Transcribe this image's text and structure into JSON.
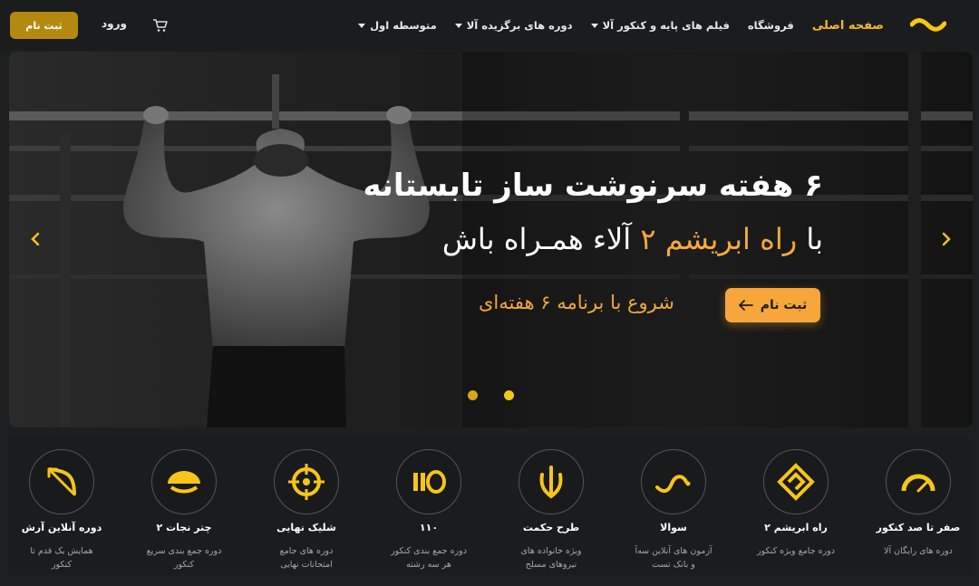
{
  "nav": {
    "menu": [
      {
        "label": "صفحه اصلی",
        "active": true,
        "dropdown": false
      },
      {
        "label": "فروشگاه",
        "active": false,
        "dropdown": false
      },
      {
        "label": "فیلم های پایه و کنکور آلا",
        "active": false,
        "dropdown": true
      },
      {
        "label": "دوره های برگزیده آلا",
        "active": false,
        "dropdown": true
      },
      {
        "label": "متوسطه اول",
        "active": false,
        "dropdown": true
      }
    ],
    "login_label": "ورود",
    "register_label": "ثبت نام",
    "accent_color": "#f5b82e"
  },
  "hero": {
    "headline_1": "۶ هفته سرنوشت ساز تابستانه",
    "headline_2_prefix": "با",
    "headline_2_accent": "راه ابریشم ۲",
    "headline_2_suffix": "آلاء همـراه باش",
    "subtext": "شروع با برنامه ۶ هفته‌ای",
    "button_label": "ثبت نام",
    "slide_count": 2,
    "active_slide": 2
  },
  "cards": [
    {
      "icon": "speedometer-icon",
      "title": "صفر تا صد کنکور",
      "desc": "دوره های رایگان آلا"
    },
    {
      "icon": "silk-road-icon",
      "title": "راه ابریشم ۲",
      "desc": "دوره جامع ویژه کنکور"
    },
    {
      "icon": "wave-icon",
      "title": "سوالا",
      "desc": "آزمون های آنلاین سه‌آ و بانک تست"
    },
    {
      "icon": "hands-icon",
      "title": "طرح حکمت",
      "desc": "ویژه خانواده های نیروهای مسلح"
    },
    {
      "icon": "110-icon",
      "title": "۱۱۰",
      "desc": "دوره جمع بندی کنکور هر سه رشته"
    },
    {
      "icon": "target-icon",
      "title": "شلیک نهایی",
      "desc": "دوره های جامع امتحانات نهایی"
    },
    {
      "icon": "parachute-icon",
      "title": "چتر نجات ۲",
      "desc": "دوره جمع بندی سریع کنکور"
    },
    {
      "icon": "bow-arrow-icon",
      "title": "دوره آنلاین آرش",
      "desc": "همایش یک قدم تا کنکور"
    }
  ]
}
